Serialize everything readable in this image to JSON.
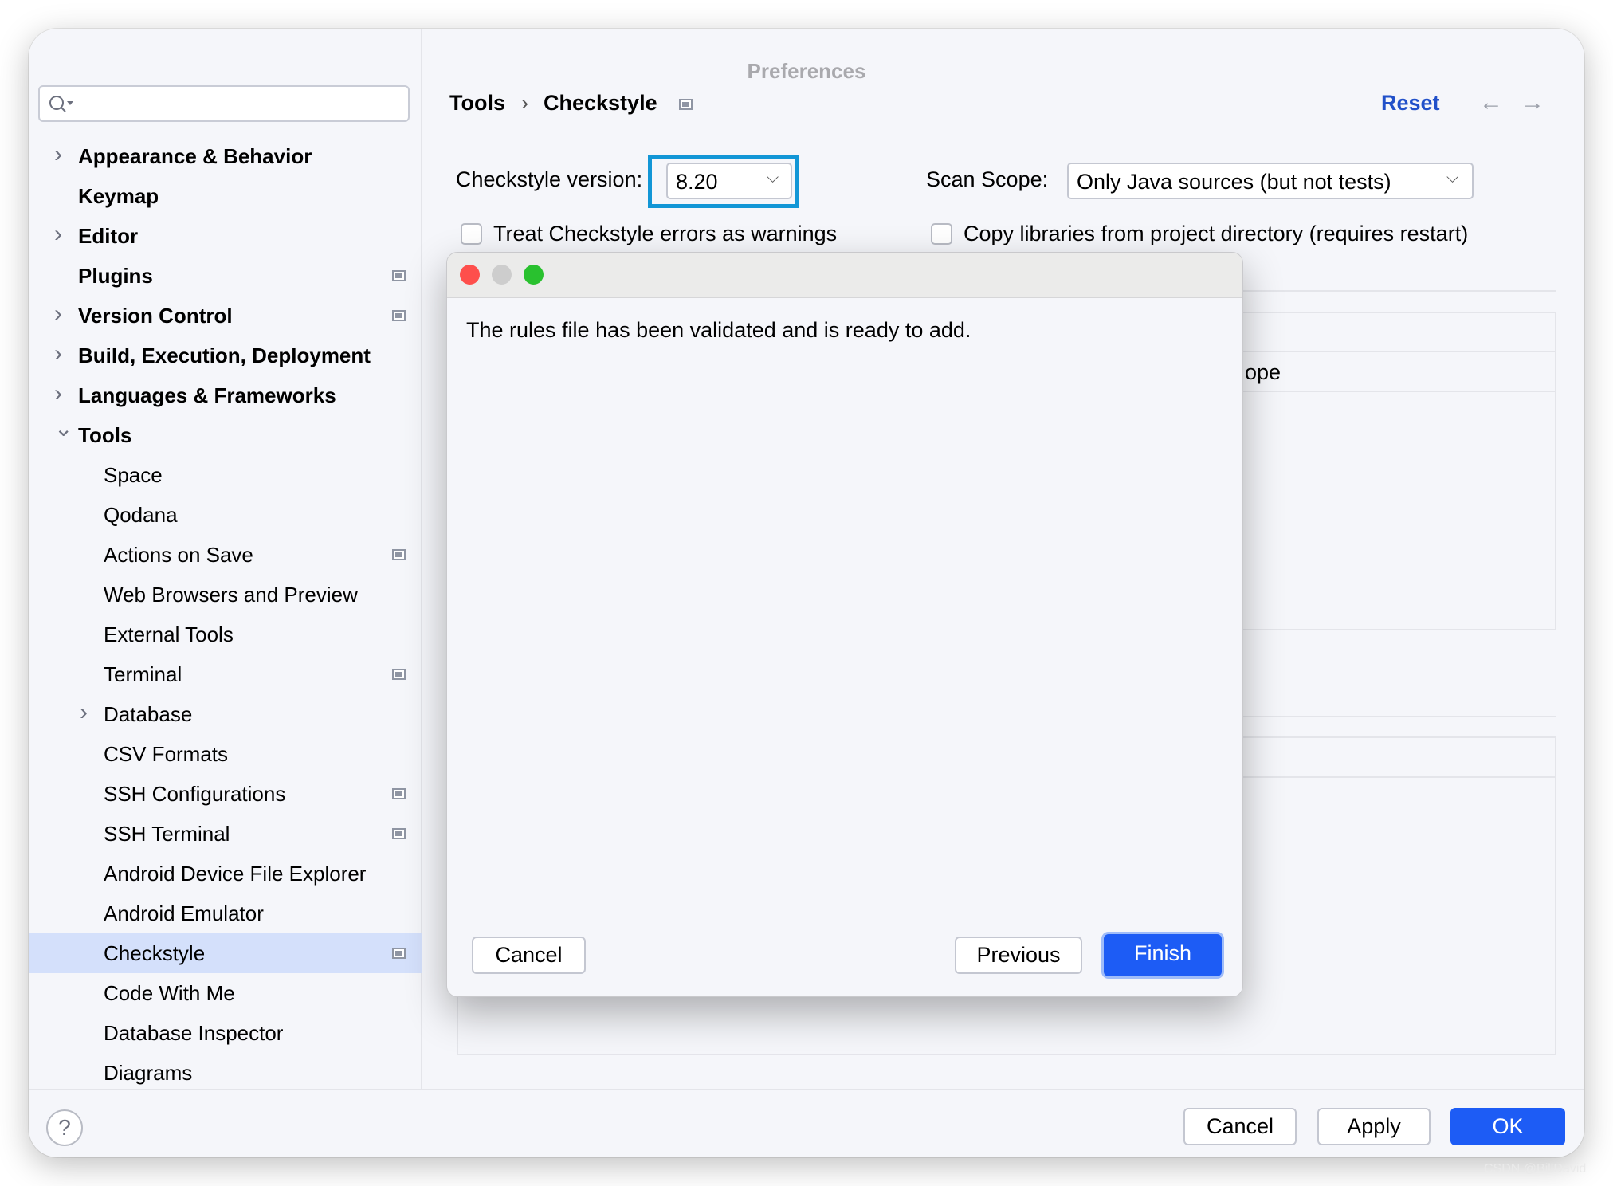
{
  "window": {
    "title": "Preferences"
  },
  "sidebar": {
    "search_placeholder": "",
    "items": [
      {
        "label": "Appearance & Behavior",
        "level": 0,
        "bold": true,
        "chevron": "right",
        "pin": false
      },
      {
        "label": "Keymap",
        "level": 0,
        "bold": true,
        "chevron": "",
        "pin": false
      },
      {
        "label": "Editor",
        "level": 0,
        "bold": true,
        "chevron": "right",
        "pin": false
      },
      {
        "label": "Plugins",
        "level": 0,
        "bold": true,
        "chevron": "",
        "pin": true
      },
      {
        "label": "Version Control",
        "level": 0,
        "bold": true,
        "chevron": "right",
        "pin": true
      },
      {
        "label": "Build, Execution, Deployment",
        "level": 0,
        "bold": true,
        "chevron": "right",
        "pin": false
      },
      {
        "label": "Languages & Frameworks",
        "level": 0,
        "bold": true,
        "chevron": "right",
        "pin": false
      },
      {
        "label": "Tools",
        "level": 0,
        "bold": true,
        "chevron": "down",
        "pin": false
      },
      {
        "label": "Space",
        "level": 1,
        "bold": false,
        "chevron": "",
        "pin": false
      },
      {
        "label": "Qodana",
        "level": 1,
        "bold": false,
        "chevron": "",
        "pin": false
      },
      {
        "label": "Actions on Save",
        "level": 1,
        "bold": false,
        "chevron": "",
        "pin": true
      },
      {
        "label": "Web Browsers and Preview",
        "level": 1,
        "bold": false,
        "chevron": "",
        "pin": false
      },
      {
        "label": "External Tools",
        "level": 1,
        "bold": false,
        "chevron": "",
        "pin": false
      },
      {
        "label": "Terminal",
        "level": 1,
        "bold": false,
        "chevron": "",
        "pin": true
      },
      {
        "label": "Database",
        "level": 1,
        "bold": false,
        "chevron": "right",
        "pin": false
      },
      {
        "label": "CSV Formats",
        "level": 1,
        "bold": false,
        "chevron": "",
        "pin": false
      },
      {
        "label": "SSH Configurations",
        "level": 1,
        "bold": false,
        "chevron": "",
        "pin": true
      },
      {
        "label": "SSH Terminal",
        "level": 1,
        "bold": false,
        "chevron": "",
        "pin": true
      },
      {
        "label": "Android Device File Explorer",
        "level": 1,
        "bold": false,
        "chevron": "",
        "pin": false
      },
      {
        "label": "Android Emulator",
        "level": 1,
        "bold": false,
        "chevron": "",
        "pin": false
      },
      {
        "label": "Checkstyle",
        "level": 1,
        "bold": false,
        "chevron": "",
        "pin": true,
        "selected": true
      },
      {
        "label": "Code With Me",
        "level": 1,
        "bold": false,
        "chevron": "",
        "pin": false
      },
      {
        "label": "Database Inspector",
        "level": 1,
        "bold": false,
        "chevron": "",
        "pin": false
      },
      {
        "label": "Diagrams",
        "level": 1,
        "bold": false,
        "chevron": "",
        "pin": false
      }
    ]
  },
  "header": {
    "breadcrumb": [
      "Tools",
      "Checkstyle"
    ],
    "separator": "›",
    "reset_label": "Reset",
    "back_icon": "←",
    "forward_icon": "→"
  },
  "settings": {
    "version_label": "Checkstyle version:",
    "version_value": "8.20",
    "scope_label": "Scan Scope:",
    "scope_value": "Only Java sources (but not tests)",
    "treat_errors_label": "Treat Checkstyle errors as warnings",
    "treat_errors_checked": false,
    "copy_libs_label": "Copy libraries from project directory (requires restart)",
    "copy_libs_checked": false,
    "table_partial_header": "ope"
  },
  "dialog": {
    "message": "The rules file has been validated and is ready to add.",
    "cancel_label": "Cancel",
    "previous_label": "Previous",
    "finish_label": "Finish"
  },
  "footer": {
    "help_icon": "?",
    "cancel_label": "Cancel",
    "apply_label": "Apply",
    "ok_label": "OK"
  },
  "watermark": "CSDN @BillDavid",
  "colors": {
    "accent": "#1d5cf5",
    "selection": "#d4e0fb",
    "focus": "#1296d6",
    "link": "#2150c9"
  }
}
